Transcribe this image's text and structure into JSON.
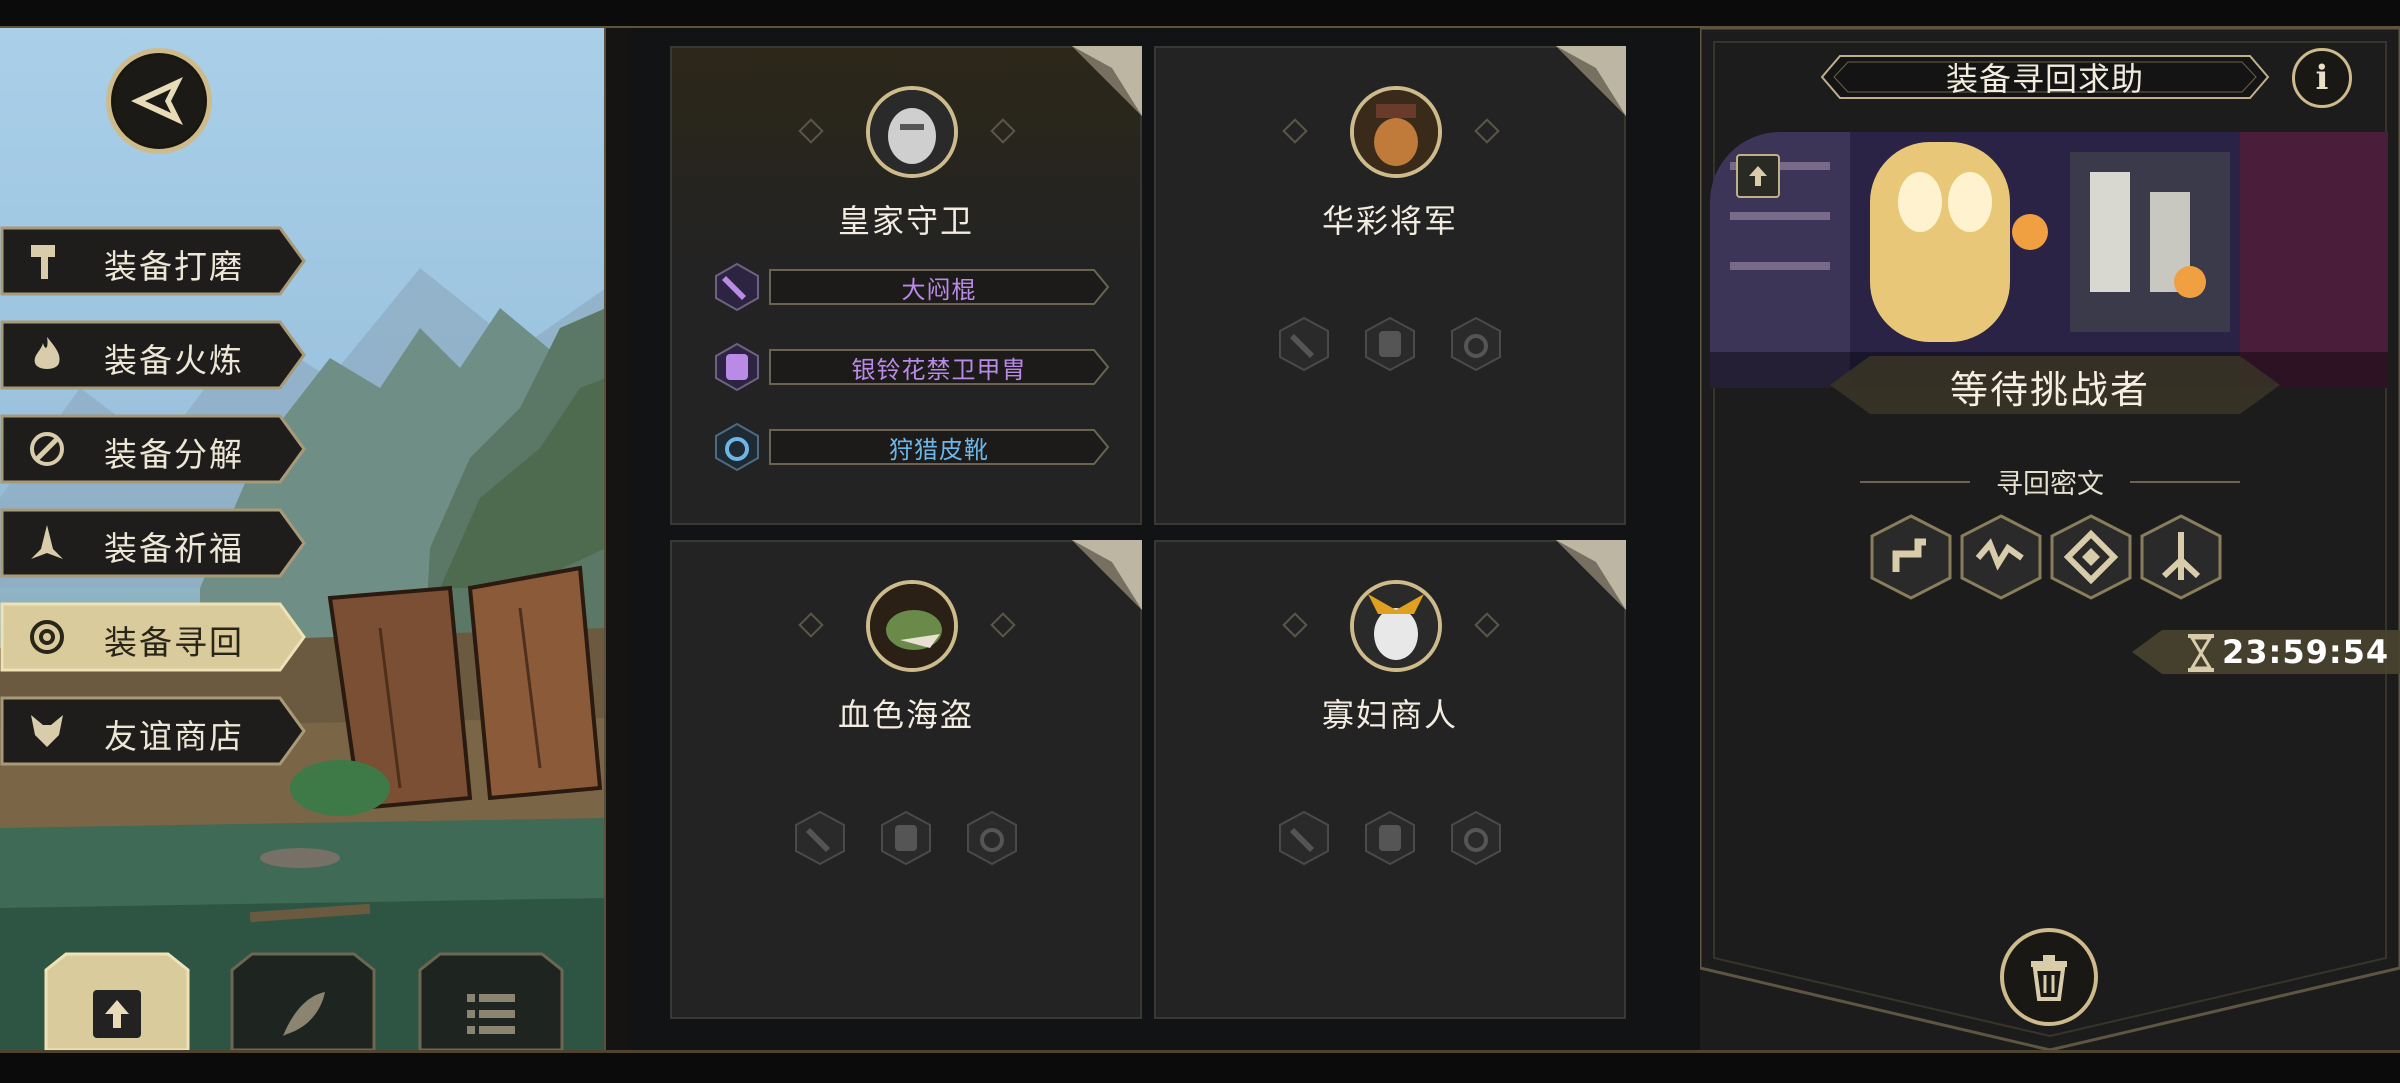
{
  "nav": {
    "menu": [
      {
        "label": "装备打磨",
        "icon": "hammer-icon"
      },
      {
        "label": "装备火炼",
        "icon": "flame-icon"
      },
      {
        "label": "装备分解",
        "icon": "decompose-icon"
      },
      {
        "label": "装备祈福",
        "icon": "pray-hands-icon"
      },
      {
        "label": "装备寻回",
        "icon": "spiral-target-icon",
        "active": true
      },
      {
        "label": "友谊商店",
        "icon": "fox-icon"
      }
    ],
    "bottom_tabs": [
      {
        "icon": "upload-file-icon",
        "active": true
      },
      {
        "icon": "feather-icon"
      },
      {
        "icon": "list-icon"
      }
    ]
  },
  "challengers": [
    {
      "name": "皇家守卫",
      "active": true,
      "equipment": [
        {
          "name": "大闷棍",
          "type": "weapon",
          "color": "#b98ae6"
        },
        {
          "name": "银铃花禁卫甲胄",
          "type": "armor",
          "color": "#b98ae6"
        },
        {
          "name": "狩猎皮靴",
          "type": "accessory",
          "color": "#6fb6e8"
        }
      ]
    },
    {
      "name": "华彩将军",
      "active": false,
      "equipment": []
    },
    {
      "name": "血色海盗",
      "active": false,
      "equipment": []
    },
    {
      "name": "寡妇商人",
      "active": false,
      "equipment": []
    }
  ],
  "right_panel": {
    "title": "装备寻回求助",
    "info_label": "i",
    "status": "等待挑战者",
    "rune_label": "寻回密文",
    "runes": [
      "rune-1-icon",
      "rune-2-icon",
      "rune-3-icon",
      "rune-4-icon"
    ],
    "timer": "23:59:54"
  },
  "colors": {
    "gold": "#cdbb8c",
    "purple_item": "#b98ae6",
    "blue_item": "#6fb6e8",
    "panel": "#232323"
  }
}
